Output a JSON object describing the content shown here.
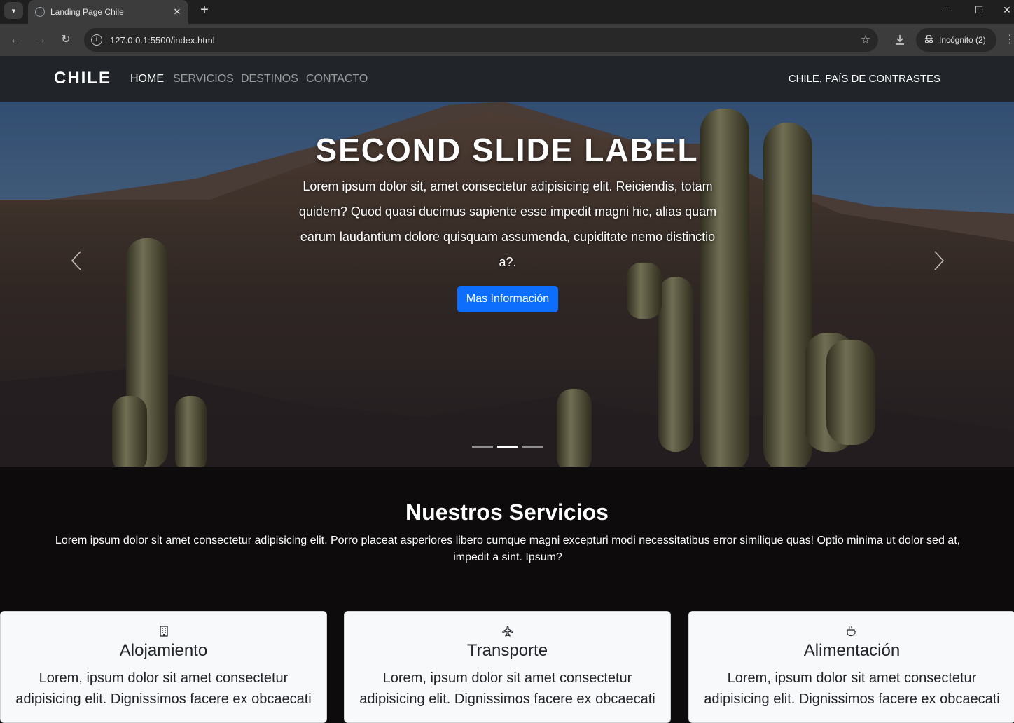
{
  "browser": {
    "tab_title": "Landing Page Chile",
    "url": "127.0.0.1:5500/index.html",
    "incognito_label": "Incógnito (2)"
  },
  "navbar": {
    "brand": "CHILE",
    "links": [
      "HOME",
      "SERVICIOS",
      "DESTINOS",
      "CONTACTO"
    ],
    "active_link": "HOME",
    "tagline": "CHILE, PAÍS DE CONTRASTES"
  },
  "hero": {
    "title": "SECOND SLIDE LABEL",
    "text": "Lorem ipsum dolor sit, amet consectetur adipisicing elit. Reiciendis, totam quidem? Quod quasi ducimus sapiente esse impedit magni hic, alias quam earum laudantium dolore quisquam assumenda, cupiditate nemo distinctio a?.",
    "button": "Mas Información",
    "slide_count": 3,
    "active_slide": 2
  },
  "services": {
    "title": "Nuestros Servicios",
    "text": "Lorem ipsum dolor sit amet consectetur adipisicing elit. Porro placeat asperiores libero cumque magni excepturi modi necessitatibus error similique quas! Optio minima ut dolor sed at, impedit a sint. Ipsum?",
    "cards": [
      {
        "icon": "building-icon",
        "title": "Alojamiento",
        "text": "Lorem, ipsum dolor sit amet consectetur adipisicing elit. Dignissimos facere ex obcaecati"
      },
      {
        "icon": "airplane-icon",
        "title": "Transporte",
        "text": "Lorem, ipsum dolor sit amet consectetur adipisicing elit. Dignissimos facere ex obcaecati"
      },
      {
        "icon": "cup-icon",
        "title": "Alimentación",
        "text": "Lorem, ipsum dolor sit amet consectetur adipisicing elit. Dignissimos facere ex obcaecati"
      }
    ]
  },
  "colors": {
    "navbar_bg": "#212529",
    "primary_button": "#0d6efd",
    "page_bg": "#0d0b0c",
    "card_bg": "#f8f9fa"
  }
}
